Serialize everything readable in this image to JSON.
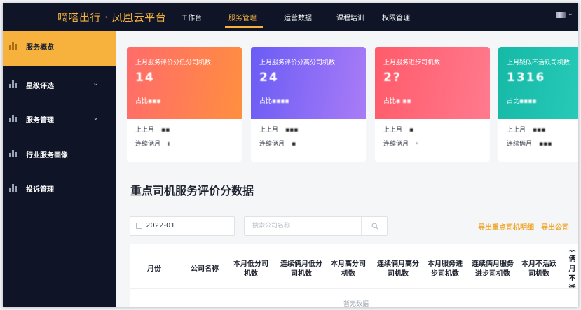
{
  "header": {
    "brand": "嘀嗒出行 · 凤凰云平台",
    "nav": [
      {
        "label": "工作台",
        "active": false
      },
      {
        "label": "服务管理",
        "active": true
      },
      {
        "label": "运营数据",
        "active": false
      },
      {
        "label": "课程培训",
        "active": false
      },
      {
        "label": "权限管理",
        "active": false
      }
    ],
    "avatar_icon": "user-avatar",
    "dropdown_icon": "chevron-down-icon",
    "dropdown_glyph": "⌄"
  },
  "sidebar": {
    "items": [
      {
        "label": "服务概览",
        "active": true,
        "expandable": false
      },
      {
        "label": "星级评选",
        "active": false,
        "expandable": true
      },
      {
        "label": "服务管理",
        "active": false,
        "expandable": true
      },
      {
        "label": "行业服务画像",
        "active": false,
        "expandable": false
      },
      {
        "label": "投诉管理",
        "active": false,
        "expandable": false
      }
    ],
    "chevron_glyph": "⌄"
  },
  "cards": [
    {
      "title": "上月服务评价分低分司机数",
      "value": "14",
      "ratio_prefix": "占比",
      "ratio_value": "▪▪▪",
      "row1_label": "上上月",
      "row1_value": "▪▪",
      "row2_label": "连续俩月",
      "row2_value": "ı",
      "color_from": "#ff6b6b",
      "color_to": "#ff8f3f"
    },
    {
      "title": "上月服务评价分高分司机数",
      "value": "24",
      "ratio_prefix": "占比",
      "ratio_value": "▪▪▪▪",
      "row1_label": "上上月",
      "row1_value": "▪▪▪",
      "row2_label": "连续俩月",
      "row2_value": "▪",
      "color_from": "#6a5cf5",
      "color_to": "#a97cf6"
    },
    {
      "title": "上月服务进步司机数",
      "value": "2?",
      "ratio_prefix": "占比",
      "ratio_value": "▪ ▪▪",
      "row1_label": "上上月",
      "row1_value": "▪",
      "row2_label": "连续俩月",
      "row2_value": "·",
      "color_from": "#ff5b6a",
      "color_to": "#ff7a8e"
    },
    {
      "title": "上月疑似不活跃司机数",
      "value": "1316",
      "ratio_prefix": "占比",
      "ratio_value": "▪▪▪▪",
      "row1_label": "上上月",
      "row1_value": "▪▪▪",
      "row2_label": "连续俩月",
      "row2_value": "▪▪▪",
      "color_from": "#16b8a6",
      "color_to": "#2cd1be"
    }
  ],
  "section": {
    "title": "重点司机服务评价分数据"
  },
  "filters": {
    "date_value": "2022-01",
    "search_placeholder": "搜索公司名称",
    "search_icon": "search-icon",
    "calendar_icon": "calendar-icon"
  },
  "exports": [
    {
      "label": "导出重点司机明细"
    },
    {
      "label": "导出公司"
    }
  ],
  "table": {
    "columns": [
      "月份",
      "公司名称",
      "本月低分司机数",
      "连续俩月低分司机数",
      "本月高分司机数",
      "连续俩月高分司机数",
      "本月服务进步司机数",
      "连续俩月服务进步司机数",
      "本月不活跃司机数",
      "连续俩月不活跃"
    ],
    "empty_text": "暂无数据"
  }
}
